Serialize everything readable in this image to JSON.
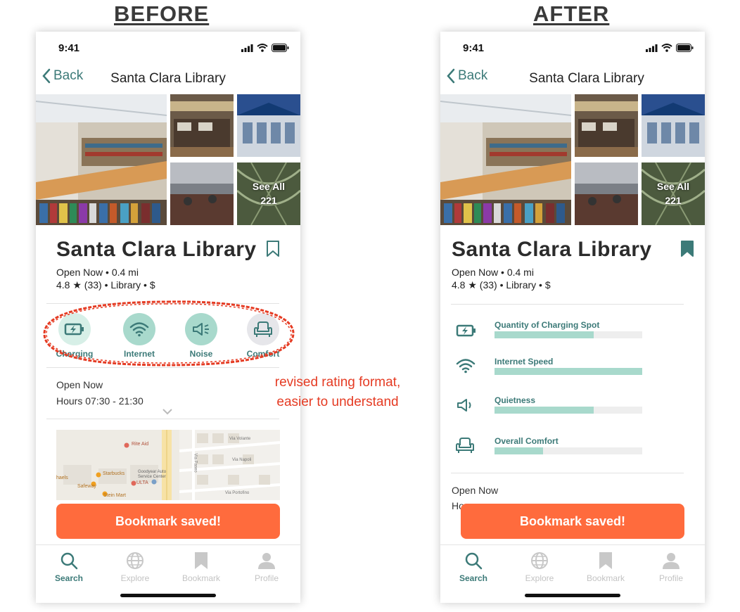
{
  "headings": {
    "before": "BEFORE",
    "after": "AFTER"
  },
  "annotation": {
    "line1": "revised rating format,",
    "line2": "easier to understand"
  },
  "colors": {
    "accent": "#3c7a78",
    "orange": "#ff6b3d",
    "mint": "#a8d9cc",
    "annotation_red": "#e53b23"
  },
  "before": {
    "status_time": "9:41",
    "back_label": "Back",
    "nav_title": "Santa Clara Library",
    "see_all": {
      "line1": "See All",
      "count": "221"
    },
    "place_title": "Santa Clara Library",
    "bookmark_state": "outline",
    "meta_line1": "Open Now • 0.4 mi",
    "meta_line2": "4.8 ★ (33) • Library • $",
    "amenities": [
      {
        "label": "Charging",
        "icon": "charging-icon",
        "active": true
      },
      {
        "label": "Internet",
        "icon": "wifi-icon",
        "active": true
      },
      {
        "label": "Noise",
        "icon": "speaker-icon",
        "active": true
      },
      {
        "label": "Comfort",
        "icon": "armchair-icon",
        "active": false
      }
    ],
    "open_status": "Open Now",
    "hours": "Hours 07:30 - 21:30",
    "map_labels": [
      "Rite Aid",
      "Starbucks",
      "Safeway",
      "Goodyear Auto Service Center",
      "ULTA",
      "Stein Mart",
      "Via Volante",
      "Via Napoli",
      "Via Portofino",
      "Via Paseo",
      "haels"
    ],
    "toast": "Bookmark saved!",
    "tabs": [
      {
        "label": "Search",
        "icon": "search-icon",
        "active": true
      },
      {
        "label": "Explore",
        "icon": "globe-icon",
        "active": false
      },
      {
        "label": "Bookmark",
        "icon": "bookmark-icon",
        "active": false
      },
      {
        "label": "Profile",
        "icon": "profile-icon",
        "active": false
      }
    ]
  },
  "after": {
    "status_time": "9:41",
    "back_label": "Back",
    "nav_title": "Santa Clara Library",
    "see_all": {
      "line1": "See All",
      "count": "221"
    },
    "place_title": "Santa Clara Library",
    "bookmark_state": "filled",
    "meta_line1": "Open Now • 0.4 mi",
    "meta_line2": "4.8 ★ (33) • Library • $",
    "ratings": [
      {
        "label": "Quantity of Charging Spot",
        "icon": "charging-icon",
        "level": 0.67
      },
      {
        "label": "Internet Speed",
        "icon": "wifi-icon",
        "level": 1.0
      },
      {
        "label": "Quietness",
        "icon": "speaker-icon",
        "level": 0.67
      },
      {
        "label": "Overall Comfort",
        "icon": "armchair-icon",
        "level": 0.33
      }
    ],
    "open_status": "Open Now",
    "hours_partial": "Ho",
    "toast": "Bookmark saved!",
    "tabs": [
      {
        "label": "Search",
        "icon": "search-icon",
        "active": true
      },
      {
        "label": "Explore",
        "icon": "globe-icon",
        "active": false
      },
      {
        "label": "Bookmark",
        "icon": "bookmark-icon",
        "active": false
      },
      {
        "label": "Profile",
        "icon": "profile-icon",
        "active": false
      }
    ]
  }
}
